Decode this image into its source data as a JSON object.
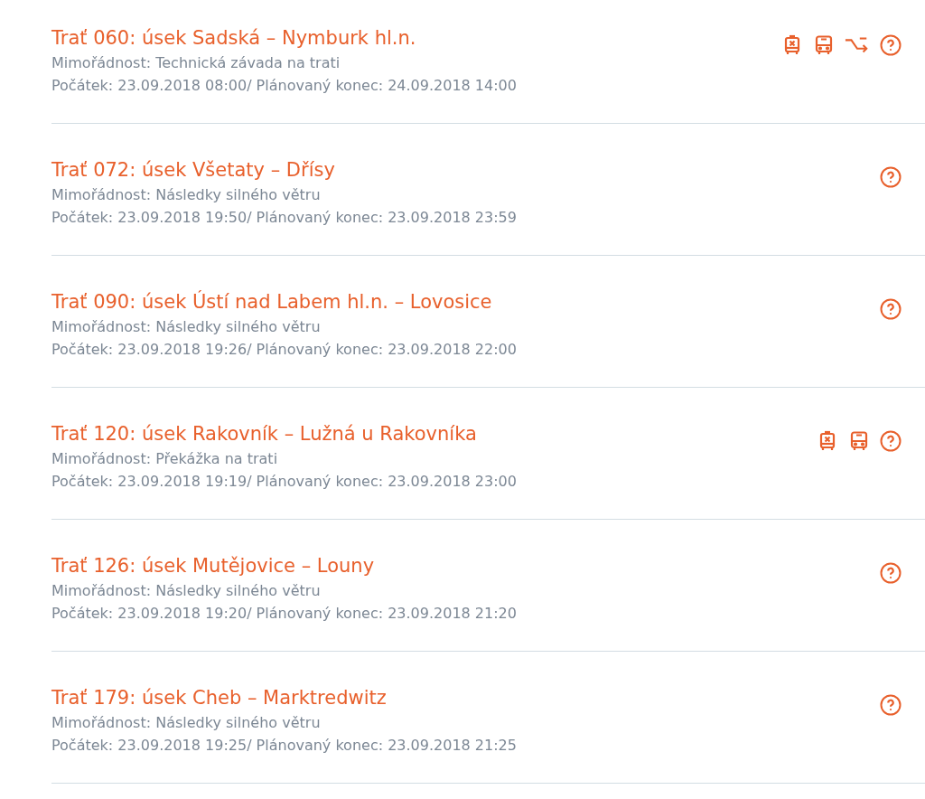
{
  "disruptions": [
    {
      "title": "Trať 060: úsek Sadská – Nymburk hl.n.",
      "reason": "Mimořádnost: Technická závada na trati",
      "period": "Počátek: 23.09.2018 08:00/ Plánovaný konec: 24.09.2018 14:00",
      "icons": [
        {
          "kind": "train-cancelled"
        },
        {
          "kind": "bus"
        },
        {
          "kind": "detour"
        },
        {
          "kind": "help"
        }
      ]
    },
    {
      "title": "Trať 072: úsek Všetaty – Dřísy",
      "reason": "Mimořádnost: Následky silného větru",
      "period": "Počátek: 23.09.2018 19:50/ Plánovaný konec: 23.09.2018 23:59",
      "icons": [
        {
          "kind": "help"
        }
      ]
    },
    {
      "title": "Trať 090: úsek Ústí nad Labem hl.n. – Lovosice",
      "reason": "Mimořádnost: Následky silného větru",
      "period": "Počátek: 23.09.2018 19:26/ Plánovaný konec: 23.09.2018 22:00",
      "icons": [
        {
          "kind": "help"
        }
      ]
    },
    {
      "title": "Trať 120: úsek Rakovník – Lužná u Rakovníka",
      "reason": "Mimořádnost: Překážka na trati",
      "period": "Počátek: 23.09.2018 19:19/ Plánovaný konec: 23.09.2018 23:00",
      "icons": [
        {
          "kind": "train-cancelled"
        },
        {
          "kind": "bus"
        },
        {
          "kind": "help"
        }
      ]
    },
    {
      "title": "Trať 126: úsek Mutějovice – Louny",
      "reason": "Mimořádnost: Následky silného větru",
      "period": "Počátek: 23.09.2018 19:20/ Plánovaný konec: 23.09.2018 21:20",
      "icons": [
        {
          "kind": "help"
        }
      ]
    },
    {
      "title": "Trať 179: úsek Cheb – Marktredwitz",
      "reason": "Mimořádnost: Následky silného větru",
      "period": "Počátek: 23.09.2018 19:25/ Plánovaný konec: 23.09.2018 21:25",
      "icons": [
        {
          "kind": "help"
        }
      ]
    }
  ]
}
